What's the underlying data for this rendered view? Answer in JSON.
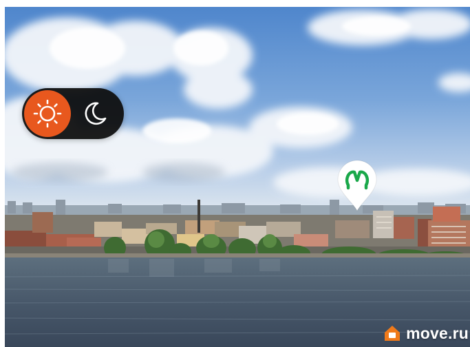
{
  "viewer": {
    "mode": "day",
    "metro_marker": {
      "icon": "metro-m-icon",
      "color": "#1aa84a"
    },
    "watermark": {
      "text": "move.ru",
      "icon": "house-logo-icon",
      "color": "#f07a1a"
    }
  },
  "toggle": {
    "day_icon": "sun-icon",
    "night_icon": "moon-icon",
    "active_color": "#e8581e"
  }
}
